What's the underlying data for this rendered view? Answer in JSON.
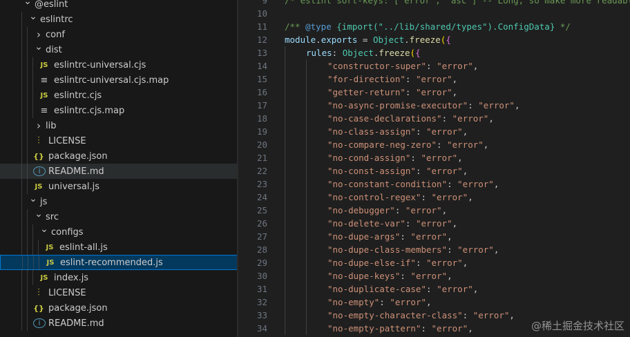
{
  "explorer": {
    "items": [
      {
        "label": "@eslint",
        "kind": "folder",
        "expanded": true,
        "depth": 1
      },
      {
        "label": "eslintrc",
        "kind": "folder",
        "expanded": true,
        "depth": 2
      },
      {
        "label": "conf",
        "kind": "folder",
        "expanded": false,
        "depth": 3
      },
      {
        "label": "dist",
        "kind": "folder",
        "expanded": true,
        "depth": 3
      },
      {
        "label": "eslintrc-universal.cjs",
        "kind": "js",
        "icon": "js-file-icon",
        "depth": 4
      },
      {
        "label": "eslintrc-universal.cjs.map",
        "kind": "map",
        "icon": "map-file-icon",
        "depth": 4
      },
      {
        "label": "eslintrc.cjs",
        "kind": "js",
        "icon": "js-file-icon",
        "depth": 4
      },
      {
        "label": "eslintrc.cjs.map",
        "kind": "map",
        "icon": "map-file-icon",
        "depth": 4
      },
      {
        "label": "lib",
        "kind": "folder",
        "expanded": false,
        "depth": 3
      },
      {
        "label": "LICENSE",
        "kind": "license",
        "icon": "license-file-icon",
        "depth": 3
      },
      {
        "label": "package.json",
        "kind": "json",
        "icon": "json-file-icon",
        "depth": 3
      },
      {
        "label": "README.md",
        "kind": "info",
        "icon": "info-file-icon",
        "depth": 3,
        "state": "hover"
      },
      {
        "label": "universal.js",
        "kind": "js",
        "icon": "js-file-icon",
        "depth": 3
      },
      {
        "label": "js",
        "kind": "folder",
        "expanded": true,
        "depth": 2
      },
      {
        "label": "src",
        "kind": "folder",
        "expanded": true,
        "depth": 3
      },
      {
        "label": "configs",
        "kind": "folder",
        "expanded": true,
        "depth": 4
      },
      {
        "label": "eslint-all.js",
        "kind": "js",
        "icon": "js-file-icon",
        "depth": 5
      },
      {
        "label": "eslint-recommended.js",
        "kind": "js",
        "icon": "js-file-icon",
        "depth": 5,
        "state": "selected"
      },
      {
        "label": "index.js",
        "kind": "js",
        "icon": "js-file-icon",
        "depth": 4
      },
      {
        "label": "LICENSE",
        "kind": "license",
        "icon": "license-file-icon",
        "depth": 3
      },
      {
        "label": "package.json",
        "kind": "json",
        "icon": "json-file-icon",
        "depth": 3
      },
      {
        "label": "README.md",
        "kind": "info",
        "icon": "info-file-icon",
        "depth": 3
      }
    ]
  },
  "editor": {
    "lines": [
      {
        "n": "9",
        "tokens": [
          [
            "comment",
            "/* eslint sort-keys: [\"error\", \"asc\"] -- Long, so make more readable */"
          ]
        ]
      },
      {
        "n": "10",
        "tokens": []
      },
      {
        "n": "11",
        "tokens": [
          [
            "comment",
            "/** "
          ],
          [
            "keyword",
            "@type"
          ],
          [
            "comment",
            " "
          ],
          [
            "type",
            "{import(\"../lib/shared/types\").ConfigData}"
          ],
          [
            "comment",
            " */"
          ]
        ]
      },
      {
        "n": "12",
        "tokens": [
          [
            "var",
            "module"
          ],
          [
            "punct",
            "."
          ],
          [
            "var",
            "exports"
          ],
          [
            "punct",
            " = "
          ],
          [
            "type",
            "Object"
          ],
          [
            "punct",
            "."
          ],
          [
            "func",
            "freeze"
          ],
          [
            "brace",
            "("
          ],
          [
            "brace2",
            "{"
          ]
        ]
      },
      {
        "n": "13",
        "indent": 1,
        "tokens": [
          [
            "var",
            "rules"
          ],
          [
            "punct",
            ": "
          ],
          [
            "type",
            "Object"
          ],
          [
            "punct",
            "."
          ],
          [
            "func",
            "freeze"
          ],
          [
            "brace",
            "("
          ],
          [
            "brace2",
            "{"
          ]
        ]
      },
      {
        "n": "14",
        "indent": 2,
        "tokens": [
          [
            "string",
            "\"constructor-super\""
          ],
          [
            "punct",
            ": "
          ],
          [
            "string",
            "\"error\""
          ],
          [
            "punct",
            ","
          ]
        ]
      },
      {
        "n": "15",
        "indent": 2,
        "tokens": [
          [
            "string",
            "\"for-direction\""
          ],
          [
            "punct",
            ": "
          ],
          [
            "string",
            "\"error\""
          ],
          [
            "punct",
            ","
          ]
        ]
      },
      {
        "n": "16",
        "indent": 2,
        "tokens": [
          [
            "string",
            "\"getter-return\""
          ],
          [
            "punct",
            ": "
          ],
          [
            "string",
            "\"error\""
          ],
          [
            "punct",
            ","
          ]
        ]
      },
      {
        "n": "17",
        "indent": 2,
        "tokens": [
          [
            "string",
            "\"no-async-promise-executor\""
          ],
          [
            "punct",
            ": "
          ],
          [
            "string",
            "\"error\""
          ],
          [
            "punct",
            ","
          ]
        ]
      },
      {
        "n": "18",
        "indent": 2,
        "tokens": [
          [
            "string",
            "\"no-case-declarations\""
          ],
          [
            "punct",
            ": "
          ],
          [
            "string",
            "\"error\""
          ],
          [
            "punct",
            ","
          ]
        ]
      },
      {
        "n": "19",
        "indent": 2,
        "tokens": [
          [
            "string",
            "\"no-class-assign\""
          ],
          [
            "punct",
            ": "
          ],
          [
            "string",
            "\"error\""
          ],
          [
            "punct",
            ","
          ]
        ]
      },
      {
        "n": "20",
        "indent": 2,
        "tokens": [
          [
            "string",
            "\"no-compare-neg-zero\""
          ],
          [
            "punct",
            ": "
          ],
          [
            "string",
            "\"error\""
          ],
          [
            "punct",
            ","
          ]
        ]
      },
      {
        "n": "21",
        "indent": 2,
        "tokens": [
          [
            "string",
            "\"no-cond-assign\""
          ],
          [
            "punct",
            ": "
          ],
          [
            "string",
            "\"error\""
          ],
          [
            "punct",
            ","
          ]
        ]
      },
      {
        "n": "22",
        "indent": 2,
        "tokens": [
          [
            "string",
            "\"no-const-assign\""
          ],
          [
            "punct",
            ": "
          ],
          [
            "string",
            "\"error\""
          ],
          [
            "punct",
            ","
          ]
        ]
      },
      {
        "n": "23",
        "indent": 2,
        "tokens": [
          [
            "string",
            "\"no-constant-condition\""
          ],
          [
            "punct",
            ": "
          ],
          [
            "string",
            "\"error\""
          ],
          [
            "punct",
            ","
          ]
        ]
      },
      {
        "n": "24",
        "indent": 2,
        "tokens": [
          [
            "string",
            "\"no-control-regex\""
          ],
          [
            "punct",
            ": "
          ],
          [
            "string",
            "\"error\""
          ],
          [
            "punct",
            ","
          ]
        ]
      },
      {
        "n": "25",
        "indent": 2,
        "tokens": [
          [
            "string",
            "\"no-debugger\""
          ],
          [
            "punct",
            ": "
          ],
          [
            "string",
            "\"error\""
          ],
          [
            "punct",
            ","
          ]
        ]
      },
      {
        "n": "26",
        "indent": 2,
        "tokens": [
          [
            "string",
            "\"no-delete-var\""
          ],
          [
            "punct",
            ": "
          ],
          [
            "string",
            "\"error\""
          ],
          [
            "punct",
            ","
          ]
        ]
      },
      {
        "n": "27",
        "indent": 2,
        "tokens": [
          [
            "string",
            "\"no-dupe-args\""
          ],
          [
            "punct",
            ": "
          ],
          [
            "string",
            "\"error\""
          ],
          [
            "punct",
            ","
          ]
        ]
      },
      {
        "n": "28",
        "indent": 2,
        "tokens": [
          [
            "string",
            "\"no-dupe-class-members\""
          ],
          [
            "punct",
            ": "
          ],
          [
            "string",
            "\"error\""
          ],
          [
            "punct",
            ","
          ]
        ]
      },
      {
        "n": "29",
        "indent": 2,
        "tokens": [
          [
            "string",
            "\"no-dupe-else-if\""
          ],
          [
            "punct",
            ": "
          ],
          [
            "string",
            "\"error\""
          ],
          [
            "punct",
            ","
          ]
        ]
      },
      {
        "n": "30",
        "indent": 2,
        "tokens": [
          [
            "string",
            "\"no-dupe-keys\""
          ],
          [
            "punct",
            ": "
          ],
          [
            "string",
            "\"error\""
          ],
          [
            "punct",
            ","
          ]
        ]
      },
      {
        "n": "31",
        "indent": 2,
        "tokens": [
          [
            "string",
            "\"no-duplicate-case\""
          ],
          [
            "punct",
            ": "
          ],
          [
            "string",
            "\"error\""
          ],
          [
            "punct",
            ","
          ]
        ]
      },
      {
        "n": "32",
        "indent": 2,
        "tokens": [
          [
            "string",
            "\"no-empty\""
          ],
          [
            "punct",
            ": "
          ],
          [
            "string",
            "\"error\""
          ],
          [
            "punct",
            ","
          ]
        ]
      },
      {
        "n": "33",
        "indent": 2,
        "tokens": [
          [
            "string",
            "\"no-empty-character-class\""
          ],
          [
            "punct",
            ": "
          ],
          [
            "string",
            "\"error\""
          ],
          [
            "punct",
            ","
          ]
        ]
      },
      {
        "n": "34",
        "indent": 2,
        "tokens": [
          [
            "string",
            "\"no-empty-pattern\""
          ],
          [
            "punct",
            ": "
          ],
          [
            "string",
            "\"error\""
          ],
          [
            "punct",
            ","
          ]
        ]
      }
    ]
  },
  "watermark": "@稀土掘金技术社区",
  "colors": {
    "sidebar_bg": "#181818",
    "editor_bg": "#1f1f1f",
    "selection_bg": "#04395e",
    "selection_border": "#0078d4",
    "string": "#ce9178",
    "keyword": "#569cd6",
    "type": "#4ec9b0",
    "variable": "#9cdcfe",
    "function": "#dcdcaa",
    "comment": "#6a9955"
  }
}
